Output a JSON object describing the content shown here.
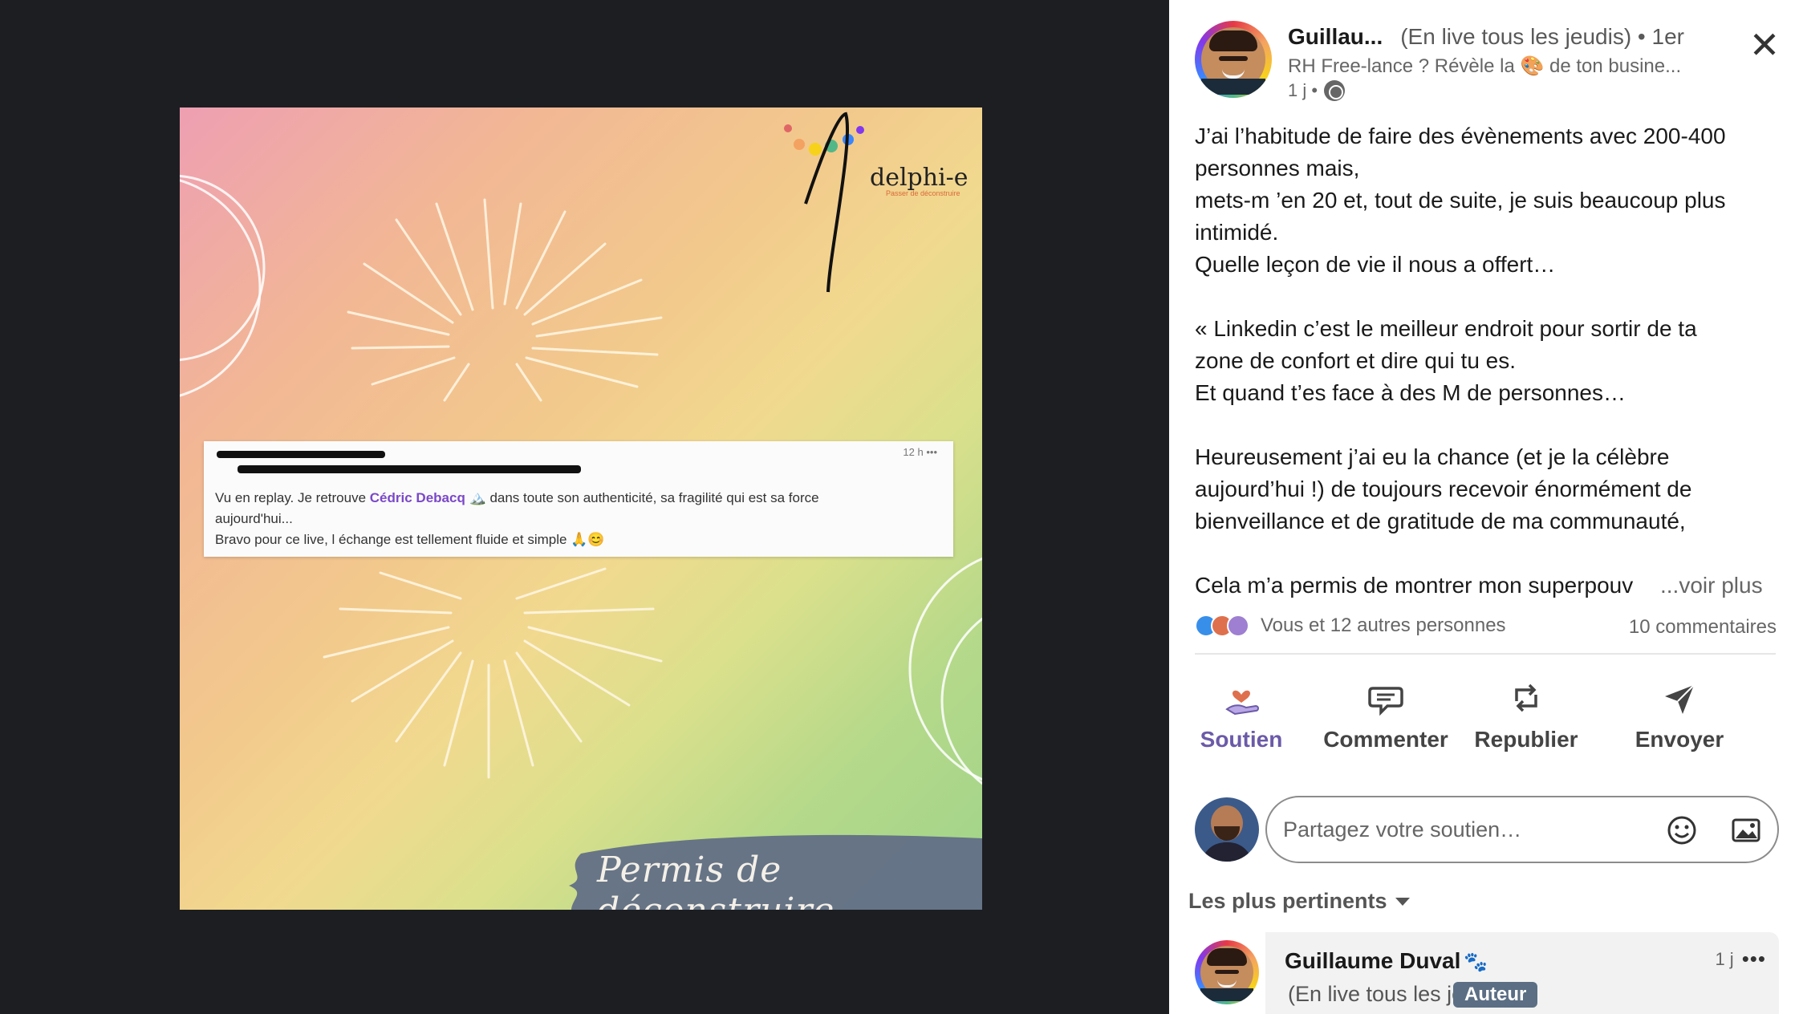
{
  "image": {
    "quote_card": {
      "time": "12 h •••",
      "line1_before": "Vu en replay. Je retrouve ",
      "mention": "Cédric Debacq",
      "line1_after": " 🏔️ dans toute son authenticité, sa fragilité qui est sa force",
      "line2": "aujourd'hui...",
      "line3": "Bravo pour ce live, l échange est tellement fluide et simple 🙏😊"
    },
    "logo_text": "delphi-e",
    "logo_sub": "Passer de déconstruire",
    "banner_text": "Permis de déconstruire ..."
  },
  "post": {
    "author": {
      "name": "Guillau...",
      "tag": "(En live tous les jeudis)",
      "degree": "• 1er",
      "headline": "RH Free-lance ? Révèle la 🎨 de ton busine...",
      "time": "1 j •"
    },
    "close_label": "✕",
    "text": "J’ai l’habitude de faire des évènements avec 200-400\npersonnes mais,\nmets-m ’en 20 et, tout de suite, je suis beaucoup plus\nintimidé.\nQuelle leçon de vie il nous a offert…\n\n« Linkedin c’est le meilleur endroit pour sortir de ta\nzone de confort et dire qui tu es.\nEt quand t’es face à des M de personnes…\n\nHeureusement j’ai eu la chance (et je la célèbre\naujourd’hui !) de toujours recevoir énormément de\nbienveillance et de gratitude de ma communauté,",
    "text_last": "Cela m’a permis de montrer mon superpouv",
    "see_more": "...voir plus",
    "reactions_text": "Vous et 12 autres personnes",
    "comments_count": "10 commentaires"
  },
  "actions": [
    {
      "label": "Soutien",
      "icon": "support-hand-icon",
      "active": true
    },
    {
      "label": "Commenter",
      "icon": "comment-icon"
    },
    {
      "label": "Republier",
      "icon": "repost-icon"
    },
    {
      "label": "Envoyer",
      "icon": "send-icon"
    }
  ],
  "comment_input": {
    "placeholder": "Partagez votre soutien…"
  },
  "sort": {
    "label": "Les plus pertinents"
  },
  "first_comment": {
    "name": "Guillaume Duval",
    "name_icon": "🐾",
    "tag": "(En live tous les jeudis)",
    "badge": "Auteur",
    "time": "1 j",
    "more": "•••"
  },
  "colors": {
    "accent": "#6b5aa8",
    "viewer_bg": "#1d1e22",
    "author_badge": "#5b6e84"
  }
}
